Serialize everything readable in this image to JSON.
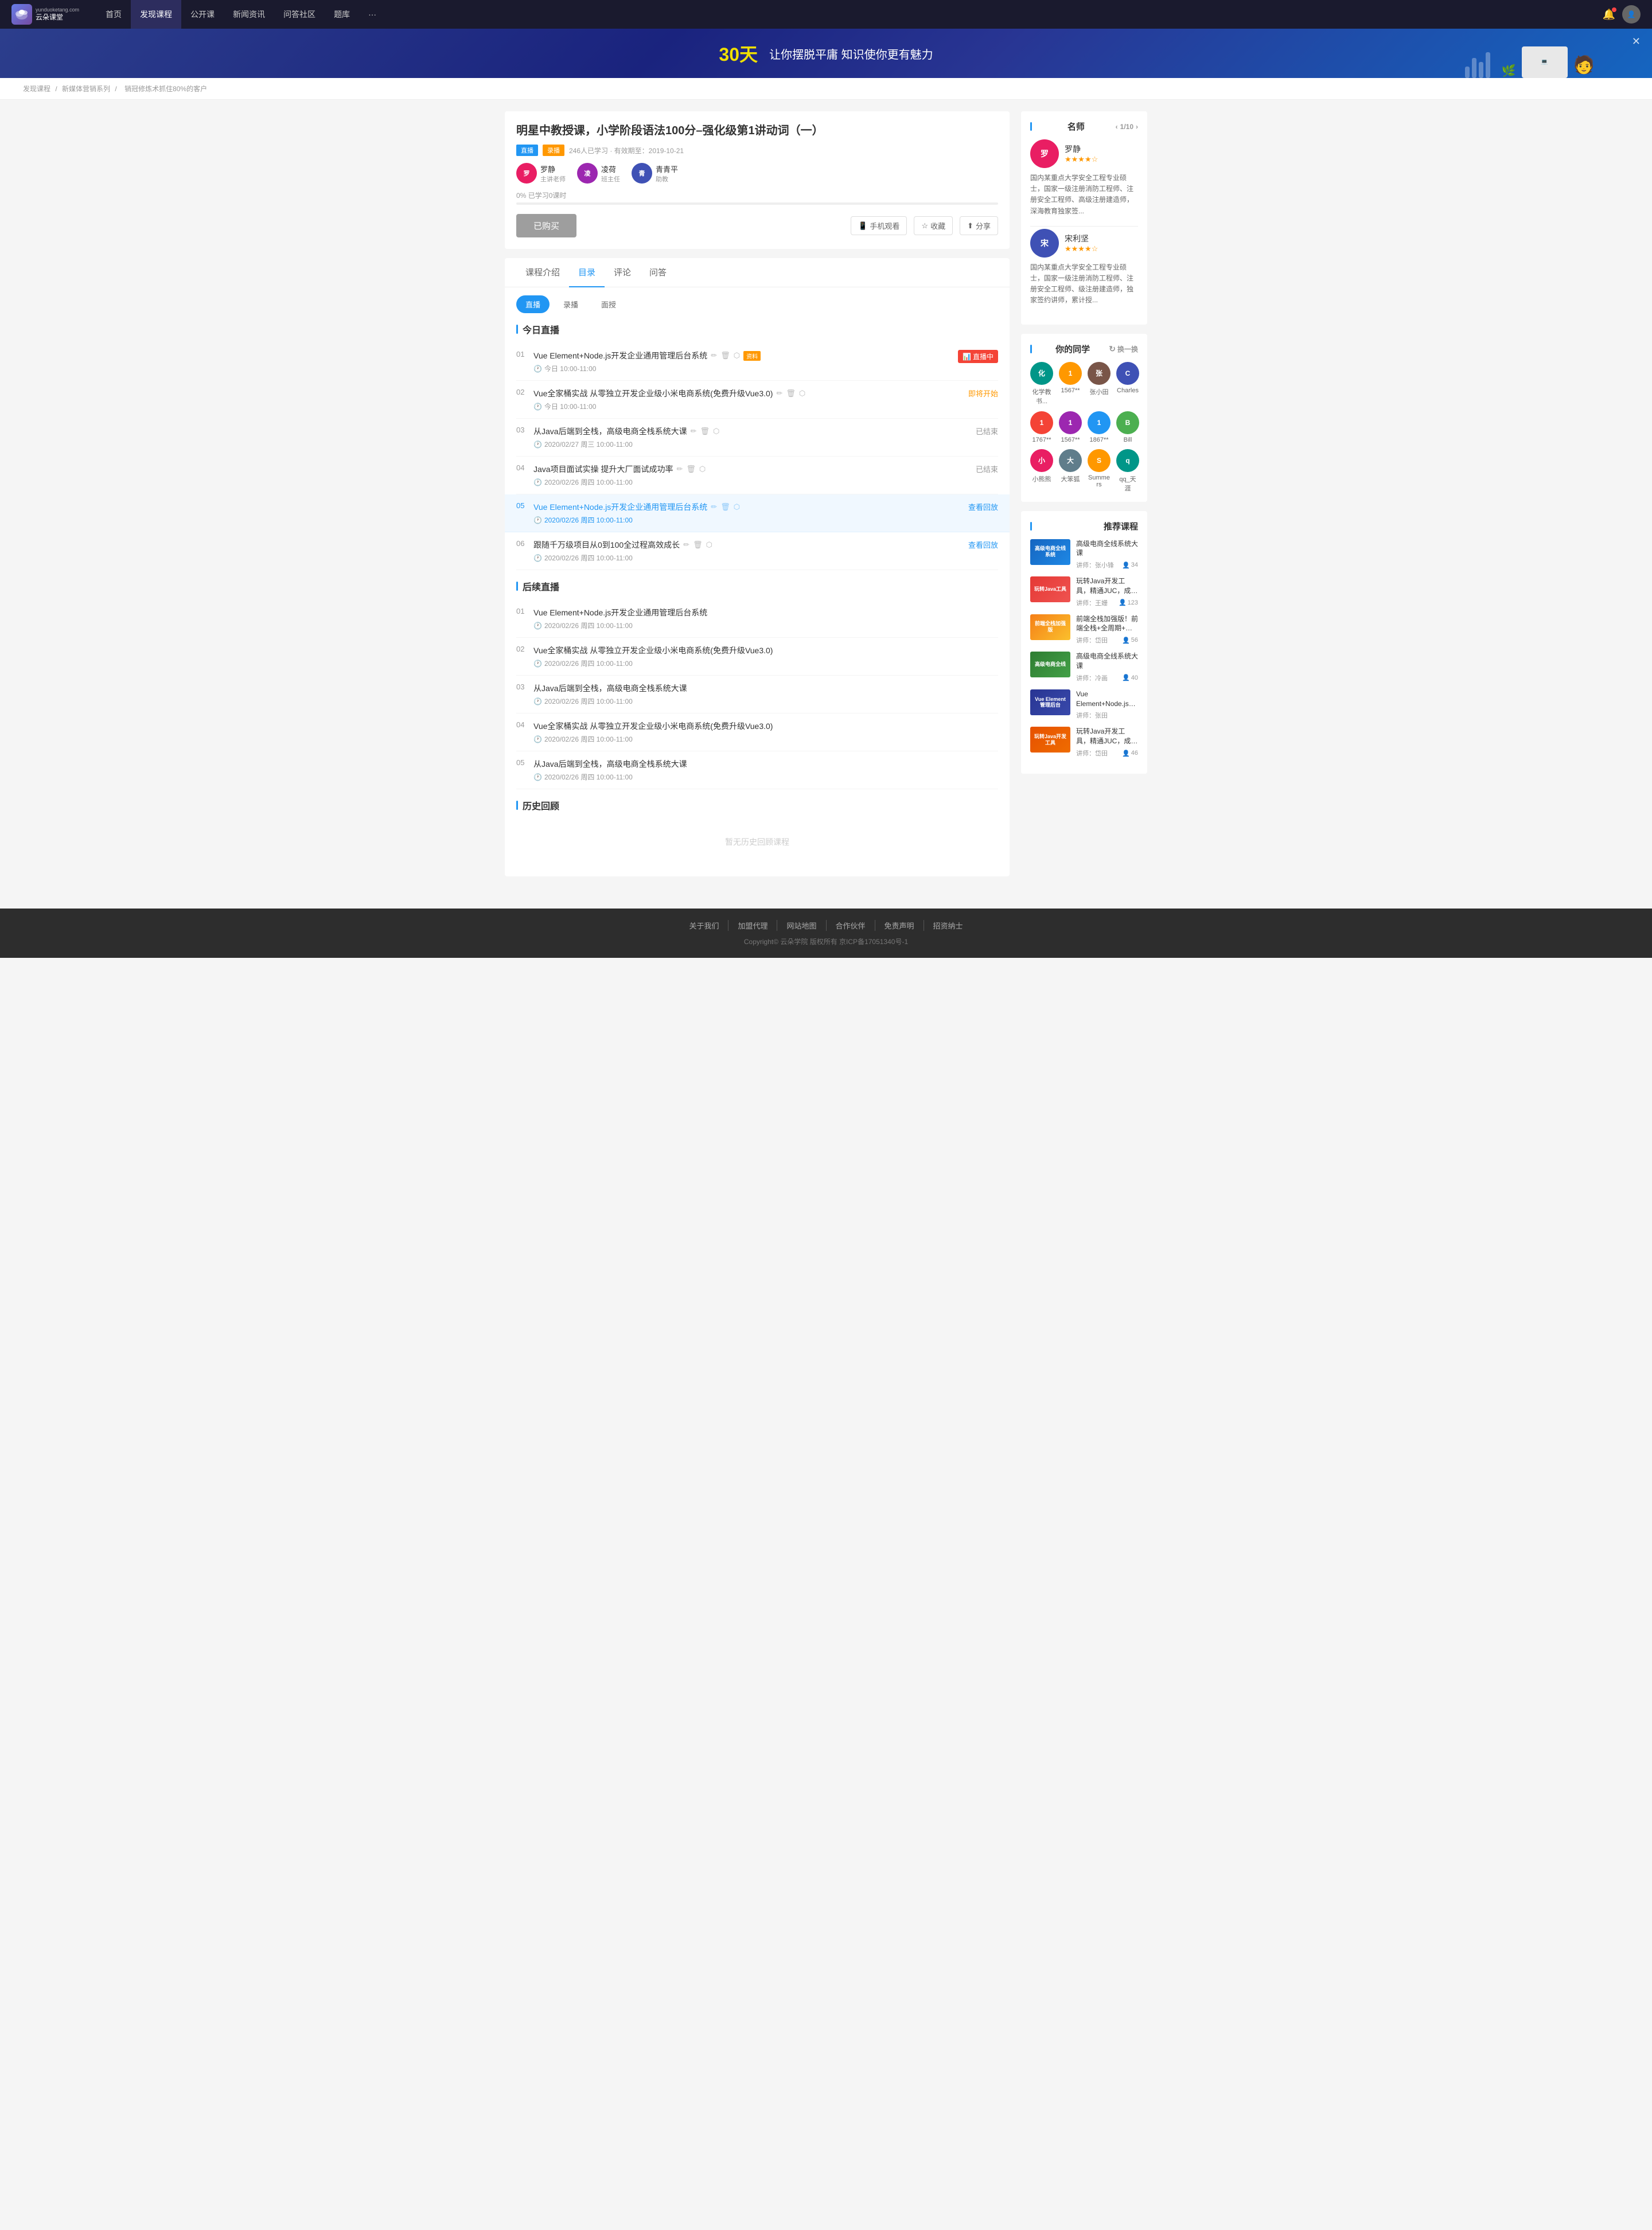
{
  "nav": {
    "logo_line1": "云朵课堂",
    "logo_abbr": "云朵课堂",
    "items": [
      {
        "label": "首页",
        "active": false
      },
      {
        "label": "发现课程",
        "active": true
      },
      {
        "label": "公开课",
        "active": false
      },
      {
        "label": "新闻资讯",
        "active": false
      },
      {
        "label": "问答社区",
        "active": false
      },
      {
        "label": "题库",
        "active": false
      },
      {
        "label": "···",
        "active": false
      }
    ]
  },
  "banner": {
    "number": "30天",
    "text": "让你摆脱平庸  知识使你更有魅力"
  },
  "breadcrumb": {
    "items": [
      "发现课程",
      "新媒体营销系列",
      "销冠修炼术抓住80%的客户"
    ]
  },
  "course": {
    "title": "明星中教授课，小学阶段语法100分–强化级第1讲动词（一）",
    "tags": [
      "直播",
      "录播"
    ],
    "meta": "246人已学习 · 有效期至：2019-10-21",
    "teachers": [
      {
        "name": "罗静",
        "role": "主讲老师",
        "color": "color-1"
      },
      {
        "name": "凌荷",
        "role": "班主任",
        "color": "color-2"
      },
      {
        "name": "青青平",
        "role": "助教",
        "color": "color-3"
      }
    ],
    "progress_label": "0%",
    "progress_sub": "已学习0课时",
    "progress_value": 0,
    "btn_buy": "已购买",
    "btn_phone": "手机观看",
    "btn_collect": "收藏",
    "btn_share": "分享"
  },
  "tabs": {
    "items": [
      "课程介绍",
      "目录",
      "评论",
      "问答"
    ],
    "active": 1
  },
  "sub_tabs": {
    "items": [
      "直播",
      "录播",
      "面授"
    ],
    "active": 0
  },
  "live_today": {
    "title": "今日直播",
    "lessons": [
      {
        "num": "01",
        "title": "Vue Element+Node.js开发企业通用管理后台系统",
        "time": "今日 10:00-11:00",
        "has_badge": true,
        "badge": "资料",
        "status": "live",
        "status_text": "直播中"
      },
      {
        "num": "02",
        "title": "Vue全家桶实战 从零独立开发企业级小米电商系统(免费升级Vue3.0)",
        "time": "今日 10:00-11:00",
        "has_badge": false,
        "status": "soon",
        "status_text": "即将开始"
      },
      {
        "num": "03",
        "title": "从Java后端到全栈，高级电商全栈系统大课",
        "time": "2020/02/27 周三 10:00-11:00",
        "has_badge": false,
        "status": "ended",
        "status_text": "已结束"
      },
      {
        "num": "04",
        "title": "Java项目面试实操 提升大厂面试成功率",
        "time": "2020/02/26 周四 10:00-11:00",
        "has_badge": false,
        "status": "ended",
        "status_text": "已结束"
      },
      {
        "num": "05",
        "title": "Vue Element+Node.js开发企业通用管理后台系统",
        "time": "2020/02/26 周四 10:00-11:00",
        "has_badge": false,
        "status": "replay",
        "status_text": "查看回放",
        "active": true
      },
      {
        "num": "06",
        "title": "跟随千万级项目从0到100全过程高效成长",
        "time": "2020/02/26 周四 10:00-11:00",
        "has_badge": false,
        "status": "replay",
        "status_text": "查看回放"
      }
    ]
  },
  "live_upcoming": {
    "title": "后续直播",
    "lessons": [
      {
        "num": "01",
        "title": "Vue Element+Node.js开发企业通用管理后台系统",
        "time": "2020/02/26 周四 10:00-11:00"
      },
      {
        "num": "02",
        "title": "Vue全家桶实战 从零独立开发企业级小米电商系统(免费升级Vue3.0)",
        "time": "2020/02/26 周四 10:00-11:00"
      },
      {
        "num": "03",
        "title": "从Java后端到全栈，高级电商全栈系统大课",
        "time": "2020/02/26 周四 10:00-11:00"
      },
      {
        "num": "04",
        "title": "Vue全家桶实战 从零独立开发企业级小米电商系统(免费升级Vue3.0)",
        "time": "2020/02/26 周四 10:00-11:00"
      },
      {
        "num": "05",
        "title": "从Java后端到全栈，高级电商全栈系统大课",
        "time": "2020/02/26 周四 10:00-11:00"
      }
    ]
  },
  "live_history": {
    "title": "历史回顾",
    "empty_text": "暂无历史回顾课程"
  },
  "sidebar": {
    "teachers_title": "名师",
    "pagination": "1/10",
    "teachers": [
      {
        "name": "罗静",
        "stars": 4,
        "color": "color-1",
        "desc": "国内某重点大学安全工程专业硕士，国家一级注册消防工程师、注册安全工程师、高级注册建造师，深海教育独家签..."
      },
      {
        "name": "宋利坚",
        "stars": 4,
        "color": "color-3",
        "desc": "国内某重点大学安全工程专业硕士，国家一级注册消防工程师、注册安全工程师、级注册建造师，独家签约讲师，累计授..."
      }
    ],
    "classmates_title": "你的同学",
    "change_btn": "换一换",
    "classmates": [
      {
        "name": "化学教书...",
        "color": "color-5"
      },
      {
        "name": "1567**",
        "color": "color-6"
      },
      {
        "name": "张小田",
        "color": "color-7"
      },
      {
        "name": "Charles",
        "color": "color-3"
      },
      {
        "name": "1767**",
        "color": "color-9"
      },
      {
        "name": "1567**",
        "color": "color-2"
      },
      {
        "name": "1867**",
        "color": "color-4"
      },
      {
        "name": "Bill",
        "color": "color-10"
      },
      {
        "name": "小熊熊",
        "color": "color-1"
      },
      {
        "name": "大笨狐",
        "color": "color-8"
      },
      {
        "name": "Summers",
        "color": "color-6"
      },
      {
        "name": "qq_天涯",
        "color": "color-5"
      }
    ],
    "recommended_title": "推荐课程",
    "recommended": [
      {
        "title": "高级电商全线系统大课",
        "lecturer": "张小锋",
        "count": "34",
        "thumb_class": "rec-thumb-1"
      },
      {
        "title": "玩转Java开发工具，精通JUC，成为开发多面手",
        "lecturer": "王姗",
        "count": "123",
        "thumb_class": "rec-thumb-2"
      },
      {
        "title": "前端全栈加强版！前端全栈+全周期+多端应用",
        "lecturer": "岱田",
        "count": "56",
        "thumb_class": "rec-thumb-3"
      },
      {
        "title": "高级电商全线系统大课",
        "lecturer": "冷画",
        "count": "40",
        "thumb_class": "rec-thumb-4"
      },
      {
        "title": "Vue Element+Node.js开发企业通用管理后台系统",
        "lecturer": "张田",
        "count": "",
        "thumb_class": "rec-thumb-5"
      },
      {
        "title": "玩转Java开发工具，精通JUC，成为开发多面手",
        "lecturer": "岱田",
        "count": "46",
        "thumb_class": "rec-thumb-6"
      }
    ]
  },
  "footer": {
    "links": [
      "关于我们",
      "加盟代理",
      "网站地图",
      "合作伙伴",
      "免责声明",
      "招资纳士"
    ],
    "copyright": "Copyright© 云朵学院  版权所有  京ICP备17051340号-1"
  }
}
